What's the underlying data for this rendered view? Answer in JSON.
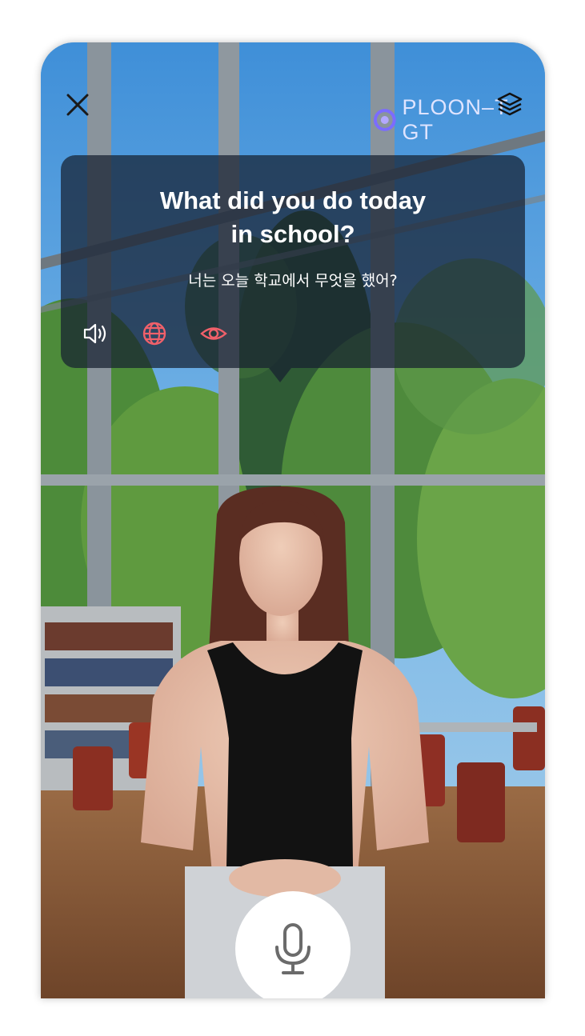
{
  "header": {
    "close_icon": "close-icon",
    "logo_text": "PLOON–T GT",
    "layers_icon": "layers-icon"
  },
  "question": {
    "english_line1": "What did you do today",
    "english_line2": "in school?",
    "korean": "너는 오늘 학교에서 무엇을 했어?"
  },
  "actions": {
    "speaker_icon": "speaker-icon",
    "translate_icon": "globe-icon",
    "view_icon": "eye-icon"
  },
  "mic": {
    "icon": "microphone-icon"
  },
  "colors": {
    "accent": "#f0606a",
    "card_bg": "#16203099",
    "logo_accent": "#7b6cff"
  }
}
